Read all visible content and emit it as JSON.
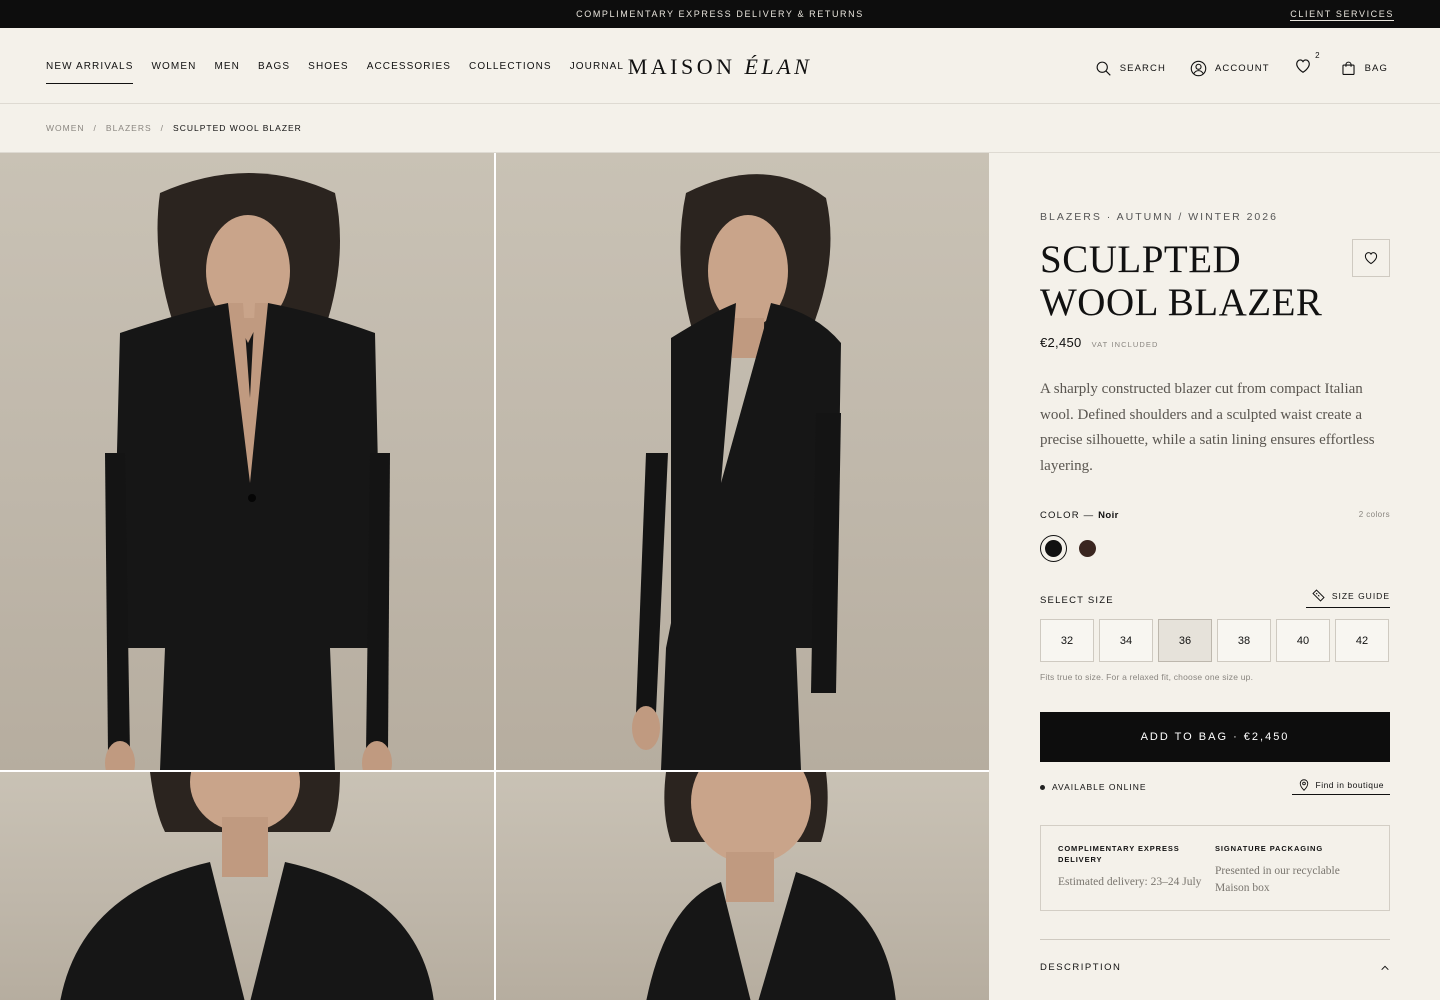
{
  "topbar": {
    "promo": "COMPLIMENTARY EXPRESS DELIVERY & RETURNS",
    "client_services": "CLIENT SERVICES"
  },
  "header": {
    "nav": [
      "NEW ARRIVALS",
      "WOMEN",
      "MEN",
      "BAGS",
      "SHOES",
      "ACCESSORIES",
      "COLLECTIONS",
      "JOURNAL"
    ],
    "active_nav": "NEW ARRIVALS",
    "logo_main": "MAISON",
    "logo_italic": "ÉLAN",
    "search": "SEARCH",
    "account": "ACCOUNT",
    "wishlist_count": "2",
    "bag": "BAG"
  },
  "breadcrumb": {
    "items": [
      "WOMEN",
      "BLAZERS"
    ],
    "current": "SCULPTED WOOL BLAZER"
  },
  "gallery": {
    "images": [
      "front-view",
      "side-view",
      "detail-left",
      "detail-right"
    ]
  },
  "product": {
    "eyebrow": "BLAZERS · AUTUMN / WINTER 2026",
    "title_line1": "SCULPTED",
    "title_line2": "WOOL BLAZER",
    "price": "€2,450",
    "vat": "VAT INCLUDED",
    "description": "A sharply constructed blazer cut from compact Italian wool. Defined shoulders and a sculpted waist create a precise silhouette, while a satin lining ensures effortless layering.",
    "color_label": "COLOR — ",
    "color_value": "Noir",
    "color_count": "2 colors",
    "colors": [
      {
        "name": "Noir",
        "hex": "#111111"
      },
      {
        "name": "Brown",
        "hex": "#3a2620"
      }
    ],
    "size_label": "SELECT SIZE",
    "size_guide": "SIZE GUIDE",
    "sizes": [
      "32",
      "34",
      "36",
      "38",
      "40",
      "42"
    ],
    "selected_size": "36",
    "fit_note": "Fits true to size. For a relaxed fit, choose one size up.",
    "add_to_bag": "ADD TO BAG · €2,450",
    "availability": "AVAILABLE ONLINE",
    "find_boutique": "Find in boutique",
    "delivery_title": "COMPLIMENTARY EXPRESS DELIVERY",
    "delivery_text": "Estimated delivery: 23–24 July",
    "packaging_title": "SIGNATURE PACKAGING",
    "packaging_text": "Presented in our recyclable Maison box",
    "description_heading": "DESCRIPTION"
  }
}
